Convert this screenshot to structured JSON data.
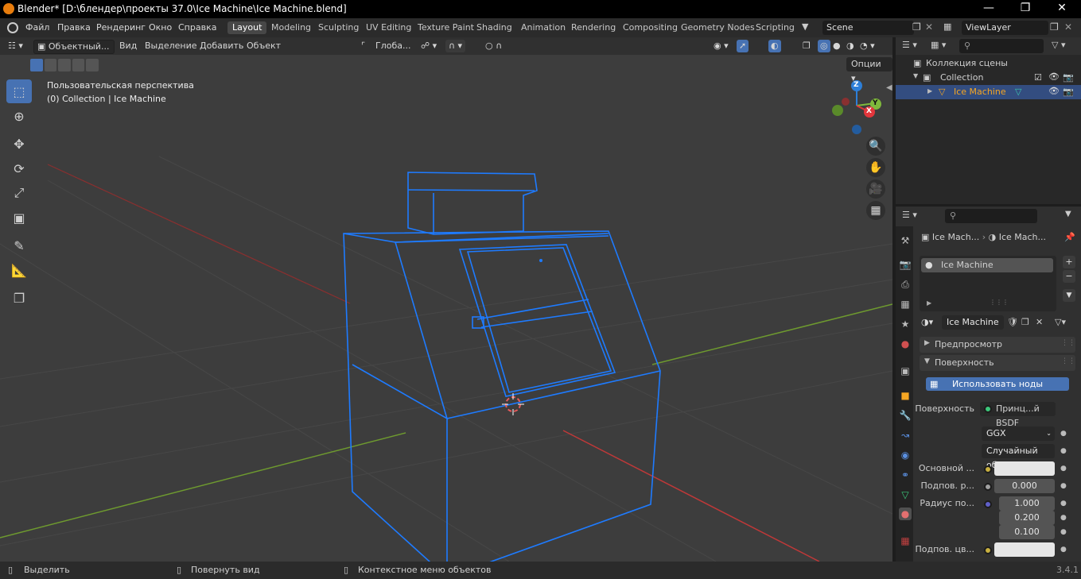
{
  "window": {
    "title": "Blender* [D:\\блендер\\проекты 37.0\\Ice Machine\\Ice Machine.blend]",
    "controls": [
      "minimize-icon",
      "maximize-icon",
      "close-icon"
    ]
  },
  "menu": [
    "Файл",
    "Правка",
    "Рендеринг",
    "Окно",
    "Справка"
  ],
  "workspaces": [
    "Layout",
    "Modeling",
    "Sculpting",
    "UV Editing",
    "Texture Paint",
    "Shading",
    "Animation",
    "Rendering",
    "Compositing",
    "Geometry Nodes",
    "Scripting"
  ],
  "active_workspace": "Layout",
  "scene": "Scene",
  "view_layer": "ViewLayer",
  "viewport": {
    "mode": "Объектный...",
    "header_menus": [
      "Вид",
      "Выделение",
      "Добавить",
      "Объект"
    ],
    "transform_orientation": "Глоба...",
    "options_label": "Опции",
    "overlay_line1": "Пользовательская перспектива",
    "overlay_line2": "(0) Collection | Ice Machine",
    "gizmo_axes": [
      "Z",
      "Y",
      "X"
    ]
  },
  "outliner": {
    "root": "Коллекция сцены",
    "collection": "Collection",
    "object": "Ice Machine"
  },
  "properties": {
    "breadcrumb_object": "Ice Mach...",
    "breadcrumb_material": "Ice Mach...",
    "slot_name": "Ice Machine",
    "material_name": "Ice Machine",
    "panel_preview": "Предпросмотр",
    "panel_surface": "Поверхность",
    "use_nodes_button": "Использовать ноды",
    "surface_label": "Поверхность",
    "surface_value": "Принц...й BSDF",
    "distribution": "GGX",
    "subsurface_method": "Случайный об...",
    "base_color_label": "Основной ...",
    "subsurface_label": "Подпов. р...",
    "subsurface_value": "0.000",
    "radius_label": "Радиус по...",
    "radius_values": [
      "1.000",
      "0.200",
      "0.100"
    ],
    "subsurface_color_label": "Подпов. цв..."
  },
  "statusbar": {
    "select": "Выделить",
    "rotate": "Повернуть вид",
    "context": "Контекстное меню объектов",
    "version": "3.4.1"
  },
  "colors": {
    "accent": "#4772b3",
    "wire": "#1e7bff",
    "active_object": "#f5a623",
    "x_axis": "#e2363c",
    "y_axis": "#7fb93c",
    "z_axis": "#2d7fd8"
  }
}
